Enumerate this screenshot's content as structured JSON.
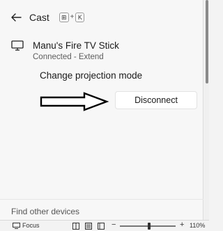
{
  "header": {
    "title": "Cast",
    "shortcut_win": "⊞",
    "shortcut_plus": "+",
    "shortcut_key": "K"
  },
  "device": {
    "name": "Manu's Fire TV Stick",
    "status": "Connected - Extend"
  },
  "actions": {
    "change_mode": "Change projection mode",
    "disconnect": "Disconnect"
  },
  "footer": {
    "find_devices": "Find other devices"
  },
  "statusbar": {
    "focus_label": "Focus",
    "zoom_minus": "−",
    "zoom_plus": "+",
    "zoom_level": "110%"
  }
}
